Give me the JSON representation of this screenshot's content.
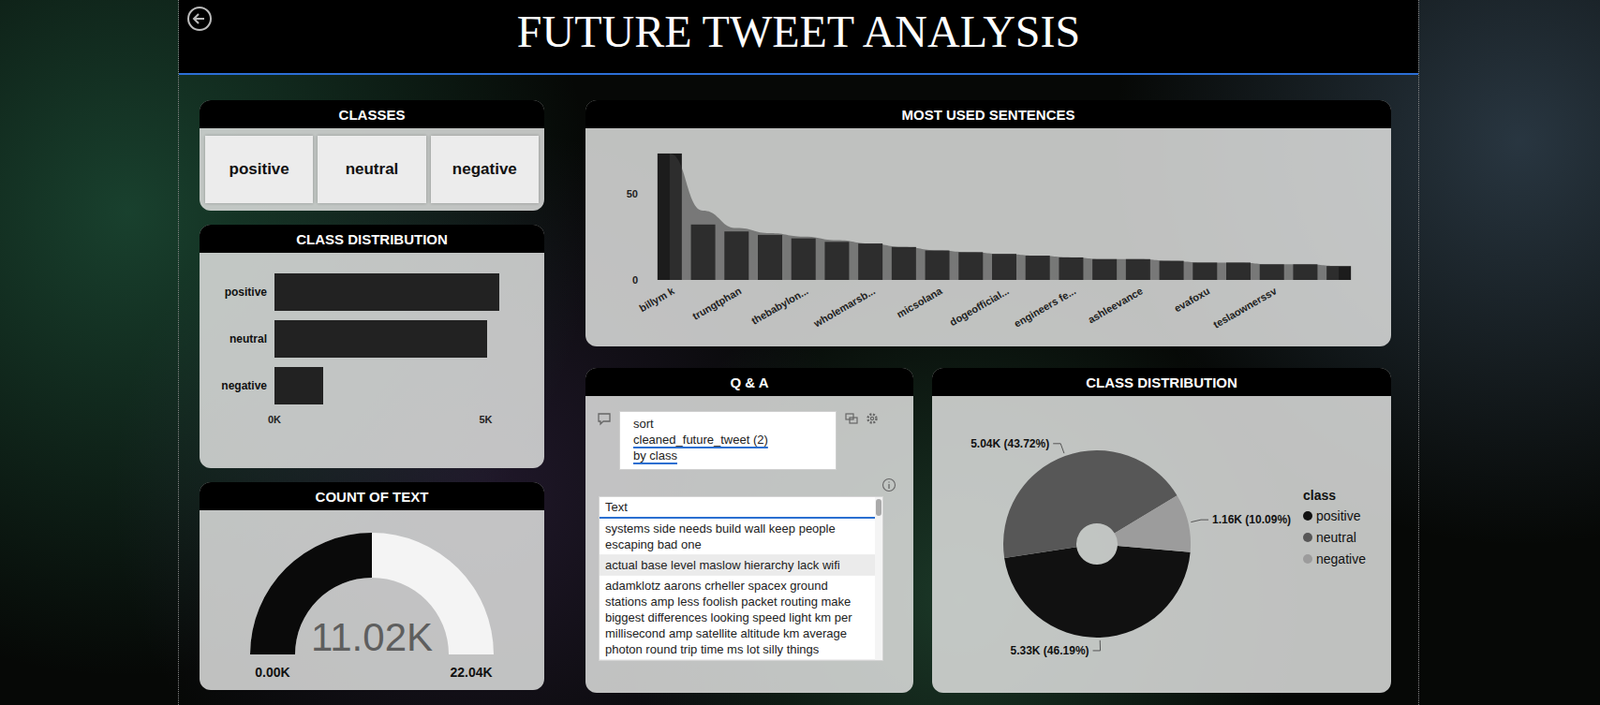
{
  "header": {
    "title": "FUTURE TWEET ANALYSIS"
  },
  "classes_slicer": {
    "title": "CLASSES",
    "items": [
      {
        "label": "positive",
        "selected": false
      },
      {
        "label": "neutral",
        "selected": false
      },
      {
        "label": "negative",
        "selected": false
      }
    ]
  },
  "class_bar_chart": {
    "title": "CLASS DISTRIBUTION",
    "axis_max": 5500,
    "ticks": [
      {
        "label": "0K",
        "value": 0
      },
      {
        "label": "5K",
        "value": 5000
      }
    ],
    "bars": [
      {
        "label": "positive",
        "value": 5330
      },
      {
        "label": "neutral",
        "value": 5040
      },
      {
        "label": "negative",
        "value": 1160
      }
    ]
  },
  "count_gauge": {
    "title": "COUNT OF TEXT",
    "value": "11.02K",
    "min": "0.00K",
    "max": "22.04K",
    "level": 0.5
  },
  "sentences_chart": {
    "title": "MOST USED SENTENCES",
    "y_max": 80,
    "y_ticks": [
      {
        "label": "0",
        "value": 0
      },
      {
        "label": "50",
        "value": 50
      }
    ],
    "x_labels": [
      "billym k",
      "trungtphan",
      "thebabylon...",
      "wholemarsb...",
      "micsolana",
      "dogeofficial...",
      "engineers fe...",
      "ashleevance",
      "evafoxu",
      "teslaownerssv"
    ],
    "bars": [
      73,
      32,
      28,
      26,
      24,
      22,
      21,
      19,
      17,
      16,
      15,
      14,
      13,
      12,
      12,
      11,
      10,
      10,
      9,
      9,
      8
    ],
    "area": [
      73,
      40,
      30,
      27,
      25,
      23,
      21,
      19,
      17,
      16,
      15,
      14,
      13,
      12,
      12,
      11,
      10,
      10,
      9,
      9,
      8
    ]
  },
  "qa": {
    "title": "Q & A",
    "query": [
      {
        "text": "sort",
        "underlined": false
      },
      {
        "text": "cleaned_future_tweet (2)",
        "underlined": true
      },
      {
        "text": "by class",
        "underlined": true
      }
    ],
    "table": {
      "column": "Text",
      "rows": [
        {
          "text": "systems side needs build wall keep people escaping bad one",
          "selected": false
        },
        {
          "text": "actual base level maslow hierarchy lack wifi",
          "selected": true
        },
        {
          "text": "adamklotz aarons crheller spacex ground stations amp less foolish packet routing make biggest differences looking speed light km per millisecond amp satellite altitude km average photon round trip time ms lot silly things",
          "selected": false
        }
      ]
    }
  },
  "class_donut": {
    "title": "CLASS DISTRIBUTION",
    "legend_title": "class",
    "slices": [
      {
        "label": "positive",
        "value": 5330,
        "reading": "5.33K (46.19%)",
        "color": "#111111"
      },
      {
        "label": "neutral",
        "value": 5040,
        "reading": "5.04K (43.72%)",
        "color": "#575757"
      },
      {
        "label": "negative",
        "value": 1160,
        "reading": "1.16K (10.09%)",
        "color": "#9c9c9c"
      }
    ]
  }
}
